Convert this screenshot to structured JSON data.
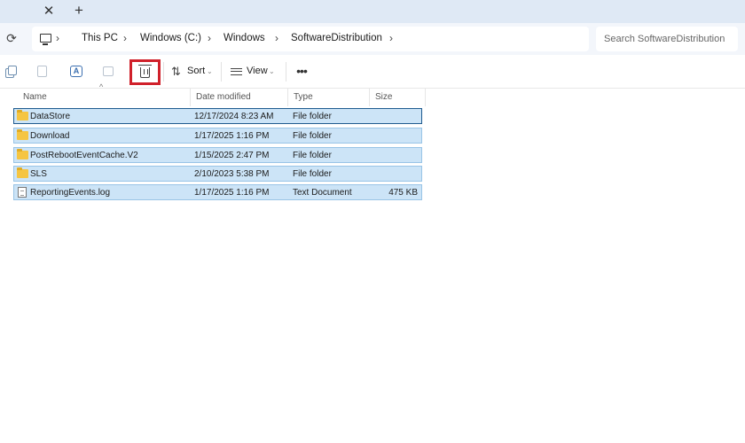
{
  "tabbar": {
    "close_glyph": "✕",
    "new_tab_glyph": "+"
  },
  "address": {
    "refresh_glyph": "⟳",
    "crumbs": [
      "This PC",
      "Windows (C:)",
      "Windows",
      "SoftwareDistribution"
    ],
    "chevron_glyph": "›"
  },
  "search": {
    "placeholder": "Search SoftwareDistribution"
  },
  "toolbar": {
    "sort_label": "Sort",
    "view_label": "View",
    "more_glyph": "•••",
    "dropdown_glyph": "⌄",
    "sort_glyph": "⇅",
    "rename_glyph": "A",
    "highlight_color": "#d0202a"
  },
  "columns": {
    "name": "Name",
    "date": "Date modified",
    "type": "Type",
    "size": "Size",
    "sort_caret": "^"
  },
  "files": [
    {
      "name": "DataStore",
      "date": "12/17/2024 8:23 AM",
      "type": "File folder",
      "size": "",
      "icon": "folder-icon"
    },
    {
      "name": "Download",
      "date": "1/17/2025 1:16 PM",
      "type": "File folder",
      "size": "",
      "icon": "folder-icon"
    },
    {
      "name": "PostRebootEventCache.V2",
      "date": "1/15/2025 2:47 PM",
      "type": "File folder",
      "size": "",
      "icon": "folder-icon"
    },
    {
      "name": "SLS",
      "date": "2/10/2023 5:38 PM",
      "type": "File folder",
      "size": "",
      "icon": "folder-icon"
    },
    {
      "name": "ReportingEvents.log",
      "date": "1/17/2025 1:16 PM",
      "type": "Text Document",
      "size": "475 KB",
      "icon": "document-icon"
    }
  ]
}
